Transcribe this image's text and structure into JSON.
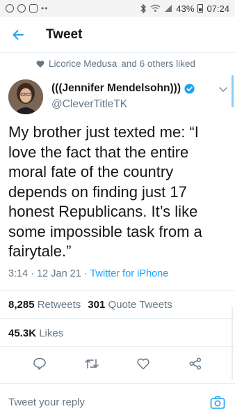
{
  "status_bar": {
    "battery": "43%",
    "time": "07:24"
  },
  "header": {
    "title": "Tweet"
  },
  "liked": {
    "name": "Licorice Medusa",
    "suffix": "and 6 others liked"
  },
  "author": {
    "display_name": "(((Jennifer Mendelsohn)))",
    "handle": "@CleverTitleTK",
    "verified": true
  },
  "tweet": {
    "text": "My brother just texted me: “I love the fact that the entire moral fate of the country depends on finding just 17 honest Republicans.  It’s like some impossible task from a fairytale.”",
    "time": "3:14 · 12 Jan 21 · ",
    "source": "Twitter for iPhone"
  },
  "stats": {
    "retweets": "8,285",
    "retweets_label": "Retweets",
    "quotes": "301",
    "quotes_label": "Quote Tweets",
    "likes": "45.3K",
    "likes_label": "Likes"
  },
  "reply": {
    "placeholder": "Tweet your reply"
  },
  "colors": {
    "accent": "#1da1f2",
    "muted": "#657786",
    "text": "#14171a",
    "divider": "#e6ecf0"
  },
  "icons": [
    "back-arrow-icon",
    "heart-icon",
    "verified-badge-icon",
    "chevron-down-icon",
    "reply-icon",
    "retweet-icon",
    "like-icon",
    "share-icon",
    "camera-icon"
  ]
}
